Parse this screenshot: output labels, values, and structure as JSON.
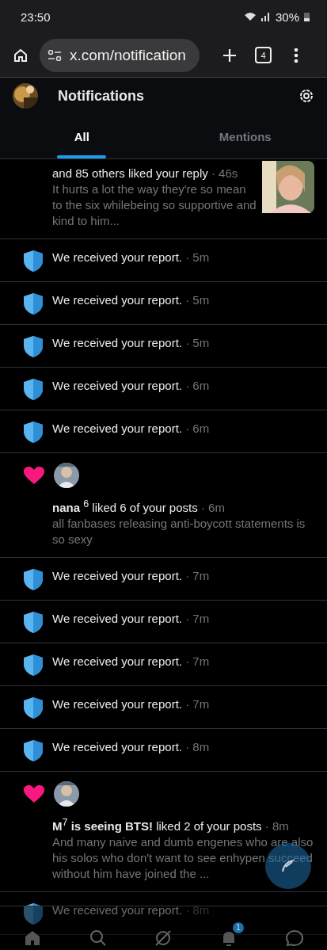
{
  "status_bar": {
    "time": "23:50",
    "battery": "30%"
  },
  "browser": {
    "url": "x.com/notification",
    "tab_count": "4"
  },
  "header": {
    "title": "Notifications"
  },
  "tabs": [
    {
      "label": "All",
      "selected": true
    },
    {
      "label": "Mentions",
      "selected": false
    }
  ],
  "notifications": [
    {
      "kind": "like",
      "text": "and 85 others liked your reply",
      "time": "46s",
      "separator": "·",
      "snippet": "It hurts a lot the way they're so mean to the six whilebeing so supportive and kind to him...",
      "avatar": false,
      "thumbnail": true
    },
    {
      "kind": "report",
      "text": "We received your report.",
      "separator": "·",
      "time": "5m"
    },
    {
      "kind": "report",
      "text": "We received your report.",
      "separator": "·",
      "time": "5m"
    },
    {
      "kind": "report",
      "text": "We received your report.",
      "separator": "·",
      "time": "5m"
    },
    {
      "kind": "report",
      "text": "We received your report.",
      "separator": "·",
      "time": "6m"
    },
    {
      "kind": "report",
      "text": "We received your report.",
      "separator": "·",
      "time": "6m"
    },
    {
      "kind": "like",
      "text": "**nana** $^{6}$ liked 6 of your posts",
      "separator": "·",
      "time": "6m",
      "snippet": "all fanbases releasing anti-boycott statements is so sexy",
      "avatar": true,
      "thumbnail": false
    },
    {
      "kind": "report",
      "text": "We received your report.",
      "separator": "·",
      "time": "7m"
    },
    {
      "kind": "report",
      "text": "We received your report.",
      "separator": "·",
      "time": "7m"
    },
    {
      "kind": "report",
      "text": "We received your report.",
      "separator": "·",
      "time": "7m"
    },
    {
      "kind": "report",
      "text": "We received your report.",
      "separator": "·",
      "time": "7m"
    },
    {
      "kind": "report",
      "text": "We received your report.",
      "separator": "·",
      "time": "8m"
    },
    {
      "kind": "like",
      "text": "**M**$^{7}$ **is seeing BTS!** liked 2 of your posts",
      "separator": "·",
      "time": "8m",
      "snippet": "And many naive and dumb engenes who are also his solos who don't want to see enhypen succeed without him have joined the ...",
      "avatar": true,
      "thumbnail": false
    },
    {
      "kind": "report",
      "text": "We received your report.",
      "separator": "·",
      "time": "8m"
    }
  ],
  "bottom_nav": {
    "badge": "1"
  }
}
